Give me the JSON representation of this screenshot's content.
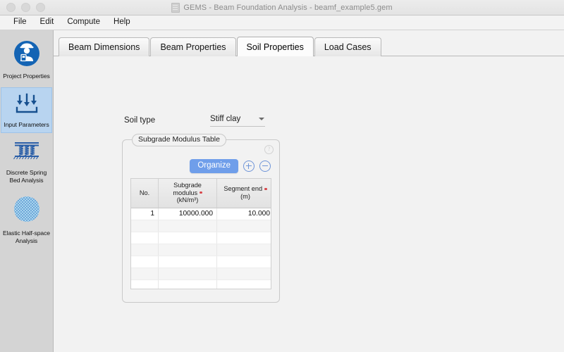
{
  "window": {
    "title": "GEMS - Beam Foundation Analysis - beamf_example5.gem",
    "doc_icon": "document-icon",
    "traffic_lights": [
      "close",
      "minimize",
      "zoom"
    ]
  },
  "menubar": {
    "items": [
      {
        "label": "File"
      },
      {
        "label": "Edit"
      },
      {
        "label": "Compute"
      },
      {
        "label": "Help"
      }
    ]
  },
  "sidebar": {
    "items": [
      {
        "label": "Project Properties",
        "icon": "engineer-icon",
        "selected": false
      },
      {
        "label": "Input Parameters",
        "icon": "input-arrows-icon",
        "selected": true
      },
      {
        "label": "Discrete Spring Bed Analysis",
        "line1": "Discrete Spring",
        "line2": "Bed Analysis",
        "icon": "spring-bed-icon",
        "selected": false
      },
      {
        "label": "Elastic Half-space Analysis",
        "line1": "Elastic Half-space",
        "line2": "Analysis",
        "icon": "half-space-icon",
        "selected": false
      }
    ]
  },
  "tabs": [
    {
      "label": "Beam Dimensions",
      "active": false
    },
    {
      "label": "Beam Properties",
      "active": false
    },
    {
      "label": "Soil Properties",
      "active": true
    },
    {
      "label": "Load Cases",
      "active": false
    }
  ],
  "form": {
    "soil_type_label": "Soil type",
    "soil_type_value": "Stiff clay",
    "caret_icon": "chevron-down-icon"
  },
  "groupbox": {
    "legend": "Subgrade Modulus Table",
    "help_icon": "help-circle-icon",
    "organize_label": "Organize",
    "add_icon": "plus-circle-icon",
    "remove_icon": "minus-circle-icon",
    "accent_color": "#6f9eea"
  },
  "table": {
    "headers": {
      "no": "No.",
      "modulus_line1": "Subgrade",
      "modulus_line2": "modulus",
      "modulus_line3": "(kN/m³)",
      "segment_line1": "Segment end",
      "segment_line2": "(m)"
    },
    "required_marker_color": "#d8464a",
    "rows": [
      {
        "no": "1",
        "modulus": "10000.000",
        "segment_end": "10.000"
      },
      {
        "no": "",
        "modulus": "",
        "segment_end": ""
      },
      {
        "no": "",
        "modulus": "",
        "segment_end": ""
      },
      {
        "no": "",
        "modulus": "",
        "segment_end": ""
      },
      {
        "no": "",
        "modulus": "",
        "segment_end": ""
      },
      {
        "no": "",
        "modulus": "",
        "segment_end": ""
      },
      {
        "no": "",
        "modulus": "",
        "segment_end": ""
      },
      {
        "no": "",
        "modulus": "",
        "segment_end": ""
      },
      {
        "no": "",
        "modulus": "",
        "segment_end": ""
      }
    ]
  }
}
